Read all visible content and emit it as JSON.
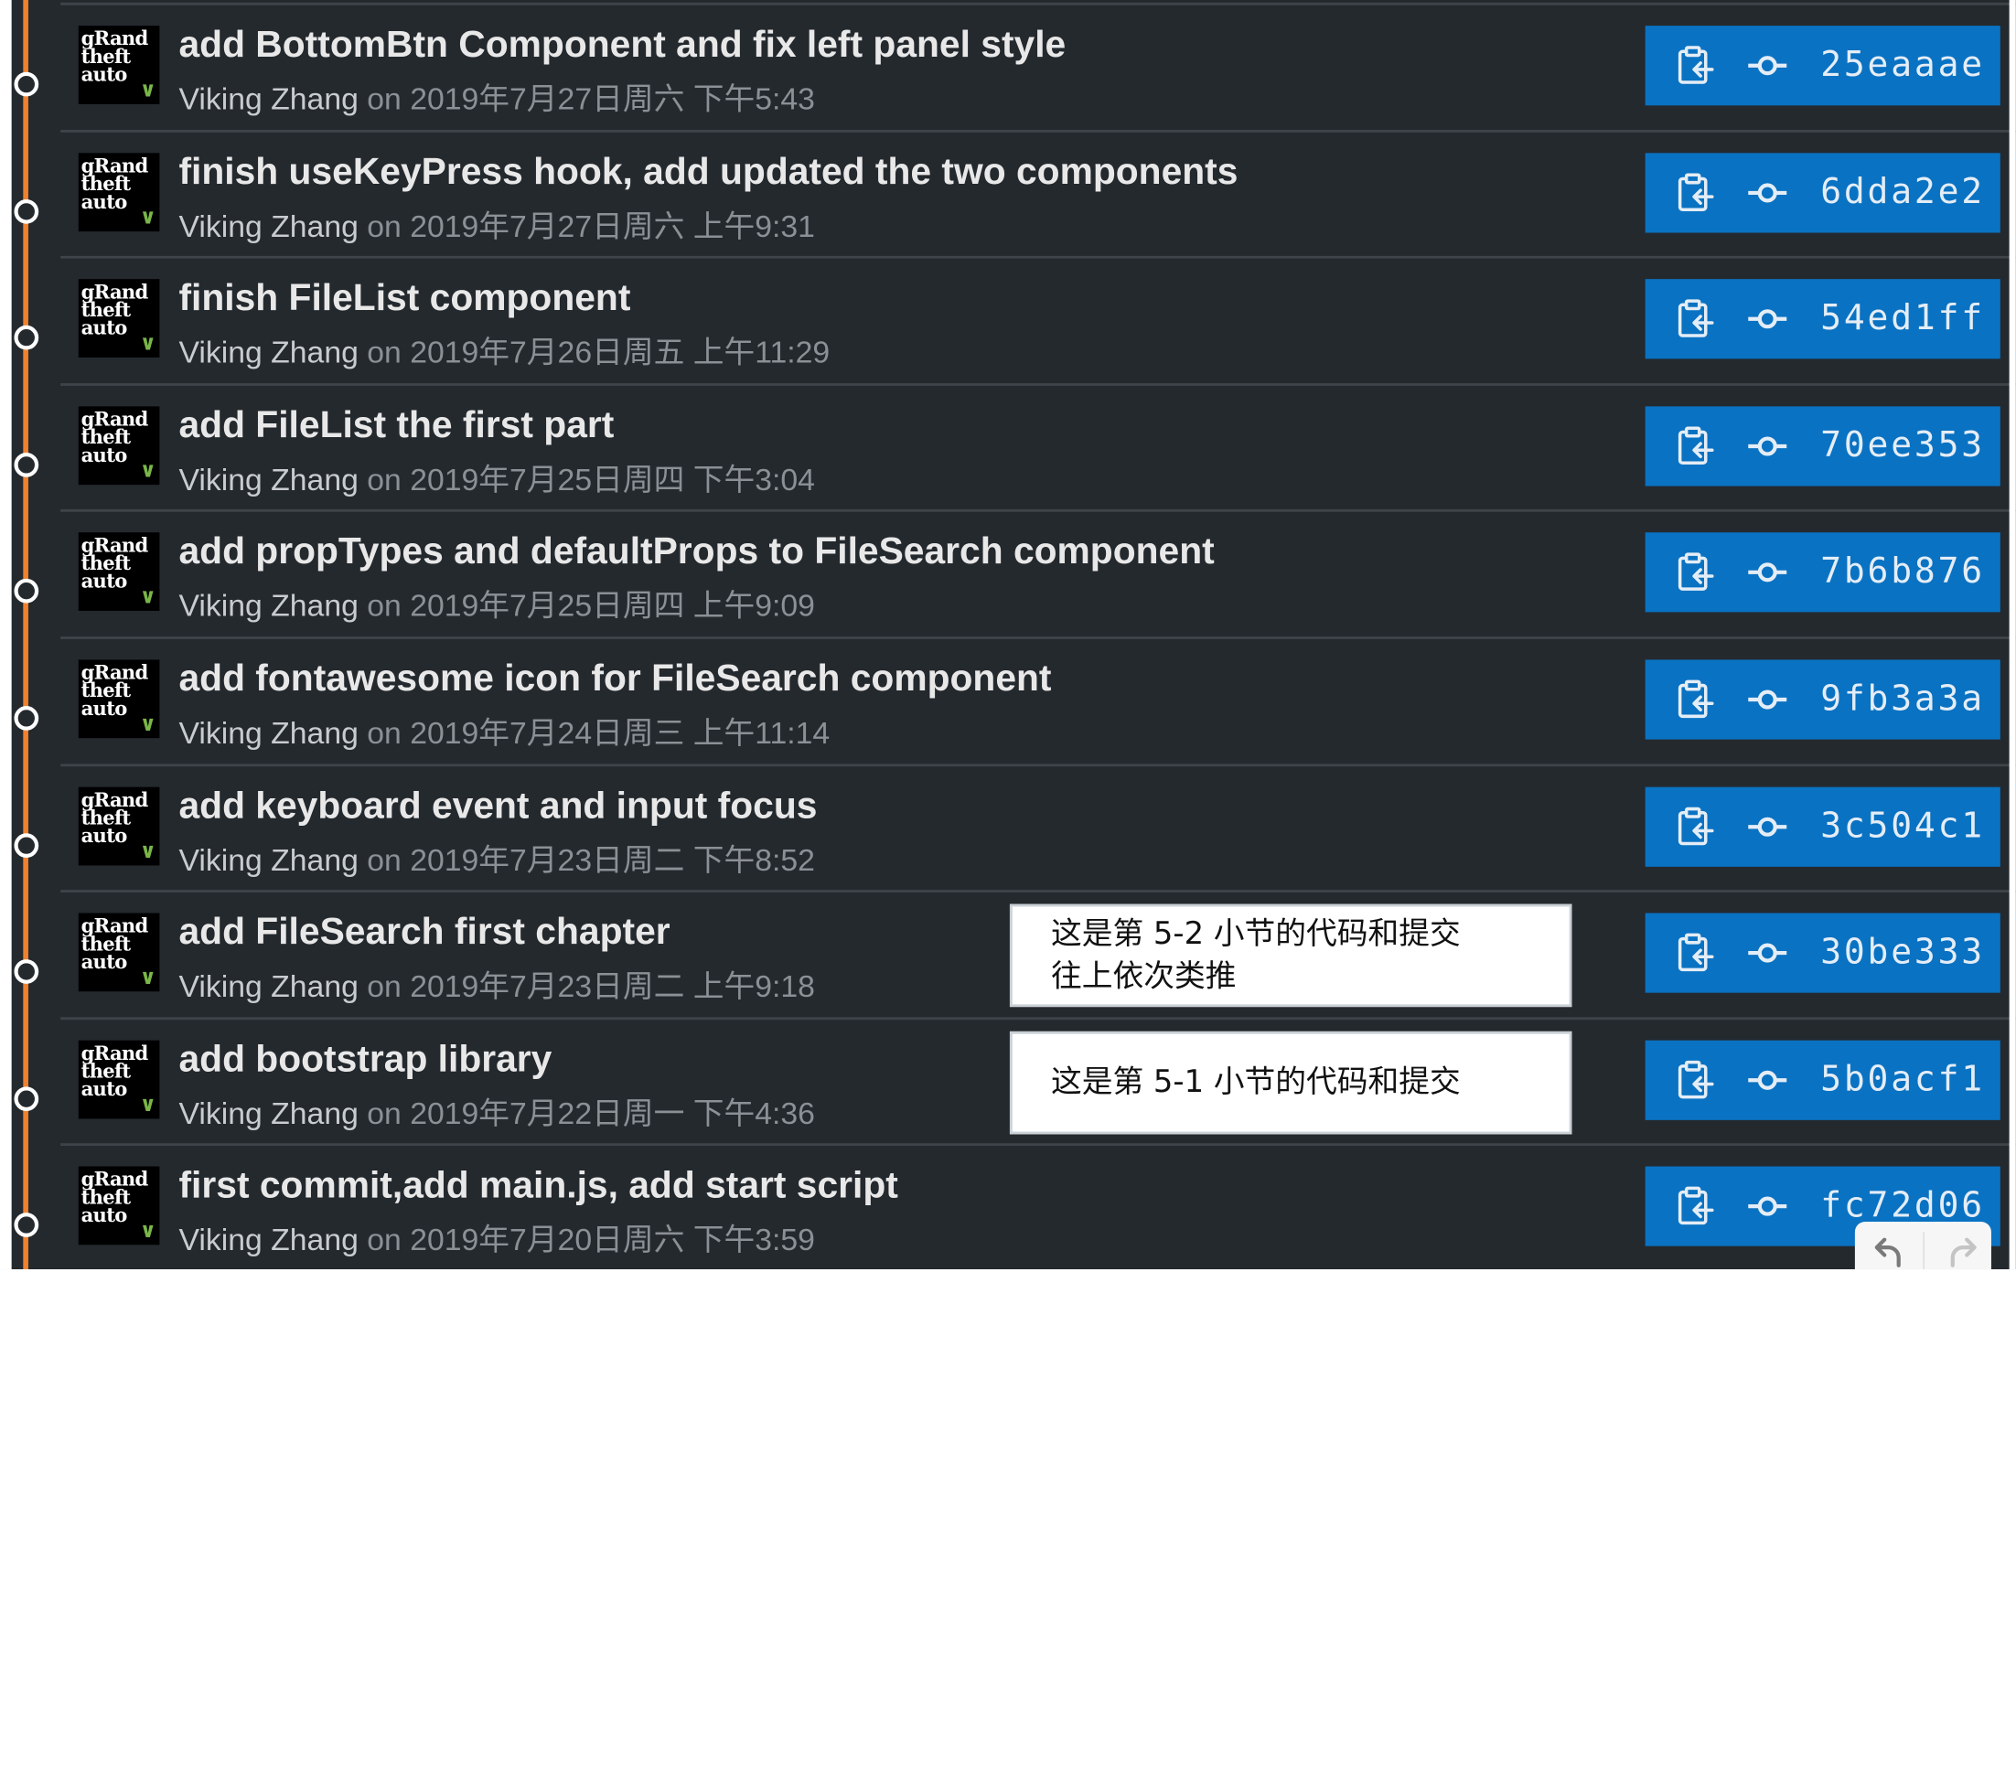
{
  "colors": {
    "background": "#24292e",
    "timeline": "#f0812e",
    "button": "#0a72c2",
    "text_primary": "#e8e8e8",
    "text_secondary": "#8b9096"
  },
  "avatar_text": [
    "gRand",
    "theft",
    "auto"
  ],
  "commits": [
    {
      "message": "add BottomBtn Component and fix left panel style",
      "author": "Viking Zhang",
      "on": "on",
      "date": "2019年7月27日周六 下午5:43",
      "sha": "25eaaae"
    },
    {
      "message": "finish useKeyPress hook, add updated the two components",
      "author": "Viking Zhang",
      "on": "on",
      "date": "2019年7月27日周六 上午9:31",
      "sha": "6dda2e2"
    },
    {
      "message": "finish FileList component",
      "author": "Viking Zhang",
      "on": "on",
      "date": "2019年7月26日周五 上午11:29",
      "sha": "54ed1ff"
    },
    {
      "message": "add FileList the first part",
      "author": "Viking Zhang",
      "on": "on",
      "date": "2019年7月25日周四 下午3:04",
      "sha": "70ee353"
    },
    {
      "message": "add propTypes and defaultProps to FileSearch component",
      "author": "Viking Zhang",
      "on": "on",
      "date": "2019年7月25日周四 上午9:09",
      "sha": "7b6b876"
    },
    {
      "message": "add fontawesome icon for FileSearch component",
      "author": "Viking Zhang",
      "on": "on",
      "date": "2019年7月24日周三 上午11:14",
      "sha": "9fb3a3a"
    },
    {
      "message": "add keyboard event and input focus",
      "author": "Viking Zhang",
      "on": "on",
      "date": "2019年7月23日周二 下午8:52",
      "sha": "3c504c1"
    },
    {
      "message": "add FileSearch first chapter",
      "author": "Viking Zhang",
      "on": "on",
      "date": "2019年7月23日周二 上午9:18",
      "sha": "30be333"
    },
    {
      "message": "add bootstrap library",
      "author": "Viking Zhang",
      "on": "on",
      "date": "2019年7月22日周一 下午4:36",
      "sha": "5b0acf1"
    },
    {
      "message": "first commit,add main.js, add start script",
      "author": "Viking Zhang",
      "on": "on",
      "date": "2019年7月20日周六 下午3:59",
      "sha": "fc72d06"
    }
  ],
  "annotations": [
    {
      "commit_index": 7,
      "lines": [
        "这是第 5-2 小节的代码和提交",
        "往上依次类推"
      ]
    },
    {
      "commit_index": 8,
      "lines": [
        "这是第 5-1 小节的代码和提交"
      ]
    }
  ],
  "icons": {
    "copy": "clipboard-copy-icon",
    "commit": "git-commit-icon",
    "undo": "undo-icon",
    "redo": "redo-icon"
  }
}
